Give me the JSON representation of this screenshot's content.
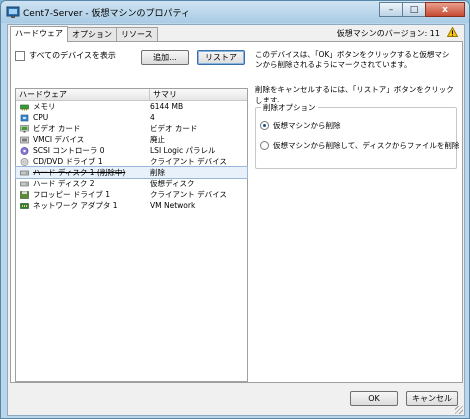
{
  "window": {
    "title": "Cent7-Server - 仮想マシンのプロパティ",
    "controls": {
      "minimize": "–",
      "maximize": "□",
      "close": "x"
    }
  },
  "tabs": [
    {
      "label": "ハードウェア"
    },
    {
      "label": "オプション"
    },
    {
      "label": "リソース"
    }
  ],
  "header": {
    "version_text": "仮想マシンのバージョン: 11"
  },
  "hardware": {
    "show_all_label": "すべてのデバイスを表示",
    "add_button": "追加...",
    "restore_button": "リストア",
    "columns": [
      "ハードウェア",
      "サマリ"
    ],
    "rows": [
      {
        "icon": "memory-icon",
        "name": "メモリ",
        "summary": "6144 MB"
      },
      {
        "icon": "cpu-icon",
        "name": "CPU",
        "summary": "4"
      },
      {
        "icon": "video-card-icon",
        "name": "ビデオ カード",
        "summary": "ビデオ カード"
      },
      {
        "icon": "vmci-device-icon",
        "name": "VMCI デバイス",
        "summary": "廃止"
      },
      {
        "icon": "scsi-controller-icon",
        "name": "SCSI コントローラ 0",
        "summary": "LSI Logic パラレル"
      },
      {
        "icon": "cd-dvd-icon",
        "name": "CD/DVD ドライブ 1",
        "summary": "クライアント デバイス"
      },
      {
        "icon": "hard-disk-icon",
        "name": "ハード ディスク 1 (削除中)",
        "summary": "削除"
      },
      {
        "icon": "hard-disk-icon",
        "name": "ハード ディスク 2",
        "summary": "仮想ディスク"
      },
      {
        "icon": "floppy-drive-icon",
        "name": "フロッピー ドライブ 1",
        "summary": "クライアント デバイス"
      },
      {
        "icon": "network-adapter-icon",
        "name": "ネットワーク アダプタ 1",
        "summary": "VM Network"
      }
    ],
    "selected_index": 6
  },
  "details": {
    "description": "このデバイスは、「OK」ボタンをクリックすると仮想マシンから削除されるようにマークされています。",
    "cancel_hint": "削除をキャンセルするには、「リストア」ボタンをクリックします。",
    "removal_group_title": "削除オプション",
    "options": [
      {
        "label": "仮想マシンから削除",
        "selected": true
      },
      {
        "label": "仮想マシンから削除して、ディスクからファイルを削除",
        "selected": false
      }
    ]
  },
  "footer": {
    "ok_button": "OK",
    "cancel_button": "キャンセル"
  },
  "colors": {
    "selection": "#e8f0f9",
    "window_frame": "#b9d6ea",
    "close_button": "#c64a32"
  }
}
